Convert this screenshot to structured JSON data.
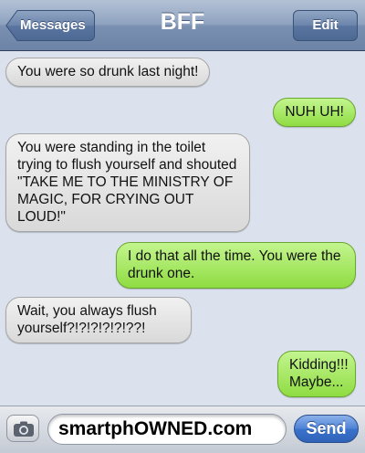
{
  "header": {
    "title": "BFF",
    "back_label": "Messages",
    "edit_label": "Edit"
  },
  "messages": [
    {
      "direction": "received",
      "text": "You were so drunk last night!"
    },
    {
      "direction": "sent",
      "text": "NUH UH!"
    },
    {
      "direction": "received",
      "text": "You were standing in the toilet trying to flush yourself and shouted \"TAKE ME TO THE MINISTRY OF MAGIC, FOR CRYING OUT LOUD!\""
    },
    {
      "direction": "sent",
      "text": "I do that all the time. You were the drunk one."
    },
    {
      "direction": "received",
      "text": "Wait, you always flush yourself?!?!?!?!?!??!"
    },
    {
      "direction": "sent",
      "text": "Kidding!!! Maybe..."
    }
  ],
  "composer": {
    "text": "smartphOWNED.com",
    "send_label": "Send",
    "camera_icon": "camera-icon"
  },
  "colors": {
    "sent_bubble": "#a8e86a",
    "received_bubble": "#e6e6e6",
    "navbar": "#8ea2bf",
    "send_button": "#3a72cc",
    "background": "#dbe2ed"
  }
}
